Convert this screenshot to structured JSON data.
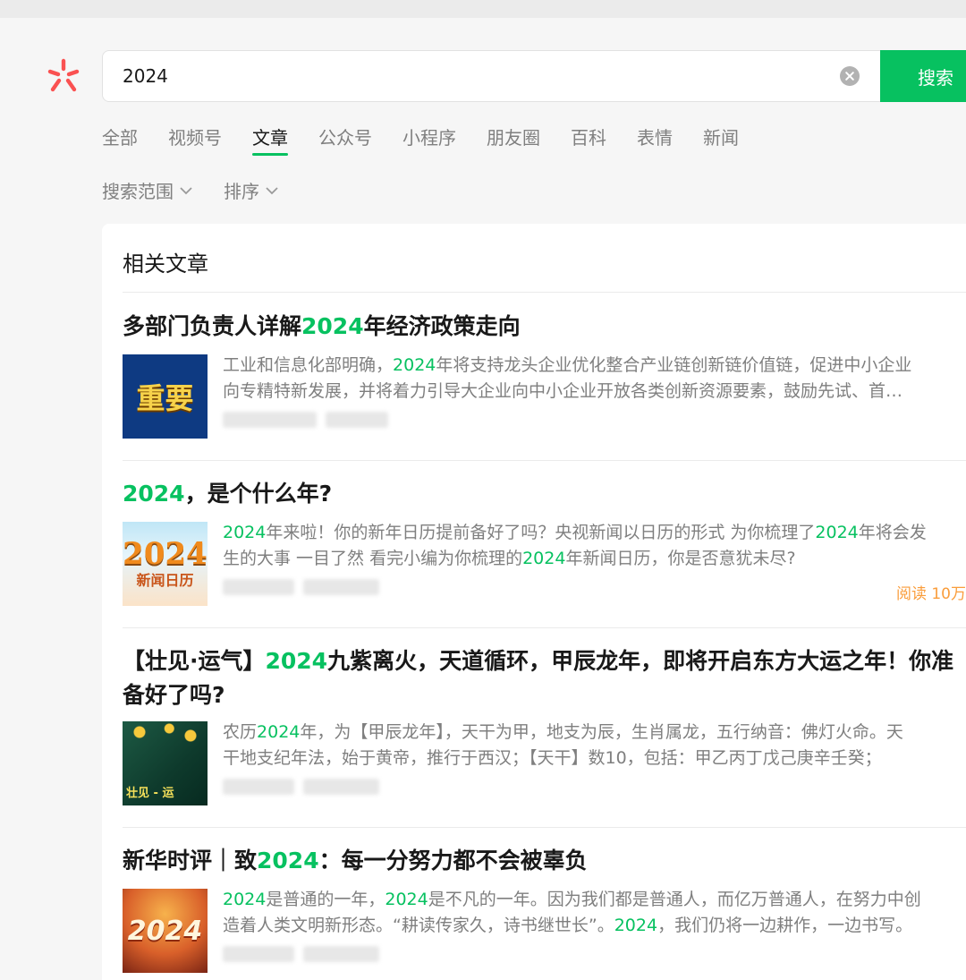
{
  "search": {
    "query": "2024",
    "button_label": "搜索"
  },
  "tabs": [
    {
      "label": "全部",
      "active": false
    },
    {
      "label": "视频号",
      "active": false
    },
    {
      "label": "文章",
      "active": true
    },
    {
      "label": "公众号",
      "active": false
    },
    {
      "label": "小程序",
      "active": false
    },
    {
      "label": "朋友圈",
      "active": false
    },
    {
      "label": "百科",
      "active": false
    },
    {
      "label": "表情",
      "active": false
    },
    {
      "label": "新闻",
      "active": false
    }
  ],
  "filters": [
    {
      "label": "搜索范围"
    },
    {
      "label": "排序"
    }
  ],
  "section": {
    "title": "相关文章"
  },
  "articles": [
    {
      "title_pre": "多部门负责人详解",
      "title_hl": "2024",
      "title_post": "年经济政策走向",
      "summary_l1_pre": "工业和信息化部明确，",
      "summary_l1_hl": "2024",
      "summary_l1_post": "年将支持龙头企业优化整合产业链创新链价值链，促进中小企业",
      "summary_l2": "向专精特新发展，并将着力引导大企业向中小企业开放各类创新资源要素，鼓励先试、首…",
      "thumb_text": "重要"
    },
    {
      "title_hl": "2024",
      "title_post": "，是个什么年?",
      "summary_l1_hl": "2024",
      "summary_l1_mid": "年来啦！你的新年日历提前备好了吗？央视新闻以日历的形式 为你梳理了",
      "summary_l1_hl2": "2024",
      "summary_l1_post": "年将会发",
      "summary_l2_pre": "生的大事 一目了然 看完小编为你梳理的",
      "summary_l2_hl": "2024",
      "summary_l2_post": "年新闻日历，你是否意犹未尽?",
      "read_count": "阅读 10万",
      "thumb_text_top": "2024",
      "thumb_text_bottom": "新闻日历"
    },
    {
      "title_pre": "【壮见·运气】",
      "title_hl": "2024",
      "title_post": "九紫离火，天道循环，甲辰龙年，即将开启东方大运之年！你准备好了吗?",
      "summary_l1_pre": "农历",
      "summary_l1_hl": "2024",
      "summary_l1_post": "年，为【甲辰龙年】，天干为甲，地支为辰，生肖属龙，五行纳音：佛灯火命。天",
      "summary_l2": "干地支纪年法，始于黄帝，推行于西汉；【天干】数10，包括：甲乙丙丁戊己庚辛壬癸；",
      "thumb_text": "壮见 - 运"
    },
    {
      "title_pre": "新华时评｜致",
      "title_hl": "2024",
      "title_post": "：每一分努力都不会被辜负",
      "summary_l1_hl": "2024",
      "summary_l1_mid": "是普通的一年，",
      "summary_l1_hl2": "2024",
      "summary_l1_post": "是不凡的一年。因为我们都是普通人，而亿万普通人，在努力中创",
      "summary_l2_pre": "造着人类文明新形态。“耕读传家久，诗书继世长”。",
      "summary_l2_hl": "2024",
      "summary_l2_post": "，我们仍将一边耕作，一边书写。",
      "thumb_text": "2024"
    }
  ],
  "colors": {
    "accent": "#07c160",
    "logo": "#fa5151",
    "read_count": "#fa9d3b"
  }
}
